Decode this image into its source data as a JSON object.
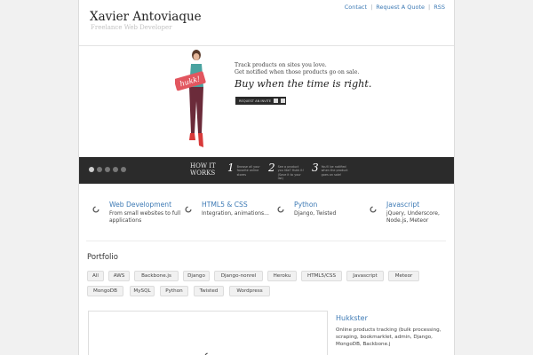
{
  "header": {
    "site_title": "Xavier Antoviaque",
    "tagline": "Freelance Web Developer",
    "nav": [
      "Contact",
      "Request A Quote",
      "RSS"
    ]
  },
  "hero": {
    "line1": "Track products on sites you love.",
    "line2": "Get notified when those products go on sale.",
    "headline": "Buy when the time is right.",
    "invite_label": "REQUEST AN INVITE",
    "sign_text": "hukk!",
    "how_title": "HOW IT WORKS",
    "steps": [
      {
        "num": "1",
        "text": "Browse all your favorite online stores"
      },
      {
        "num": "2",
        "text": "See a product you like? Hukk it! (Save it to your list)"
      },
      {
        "num": "3",
        "text": "You'll be notified when the product goes on sale!"
      }
    ],
    "slides_count": 5,
    "active_slide": 1
  },
  "services": [
    {
      "title": "Web Development",
      "desc": "From small websites to full applications"
    },
    {
      "title": "HTML5 & CSS",
      "desc": "Integration, animations..."
    },
    {
      "title": "Python",
      "desc": "Django, Twisted"
    },
    {
      "title": "Javascript",
      "desc": "jQuery, Underscore, Node.js, Meteor"
    }
  ],
  "portfolio": {
    "title": "Portfolio",
    "tags": [
      "All",
      "AWS",
      "Backbone.js",
      "Django",
      "Django-nonrel",
      "Heroku",
      "HTML5/CSS",
      "Javascript",
      "Meteor",
      "MongoDB",
      "MySQL",
      "Python",
      "Twisted",
      "Wordpress"
    ],
    "project": {
      "title": "Hukkster",
      "desc": "Online products tracking (bulk processing, scraping, bookmarklet, admin, Django, MongoDB, Backbone.j"
    }
  },
  "colors": {
    "link": "#3c79b4",
    "dark_bar": "#2b2b2b",
    "sign": "#e2565f",
    "shirt": "#4aa3a0",
    "pants": "#6b2b3a"
  },
  "icons": {
    "service": "loading-spinner-icon",
    "invite": "facebook-twitter-icons"
  }
}
